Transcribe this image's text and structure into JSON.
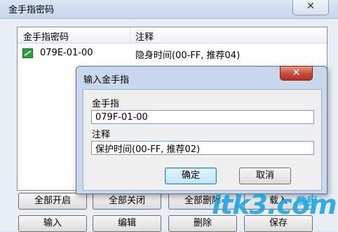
{
  "window": {
    "title": "金手指密码",
    "close_icon": "close-icon"
  },
  "list": {
    "columns": [
      "金手指密码",
      "注释"
    ],
    "rows": [
      {
        "code": "079E-01-00",
        "note": "隐身时间(00-FF, 推荐04)",
        "icon": "cheat-enabled-icon",
        "icon_color": "#2a9d3c"
      }
    ]
  },
  "buttons": {
    "enable_all": "全部开启",
    "disable_all": "全部关闭",
    "delete_all": "全部删除",
    "load": "载入",
    "input": "输入",
    "edit": "编辑",
    "delete": "删除",
    "save": "保存"
  },
  "dialog": {
    "title": "输入金手指",
    "code_label": "金手指",
    "code_value": "079F-01-00",
    "note_label": "注释",
    "note_value": "保护时间(00-FF, 推荐02)",
    "ok": "确定",
    "cancel": "取消",
    "accent": "#3c7fb1"
  },
  "watermark": {
    "main": "itk3.com",
    "sub": "教程"
  }
}
